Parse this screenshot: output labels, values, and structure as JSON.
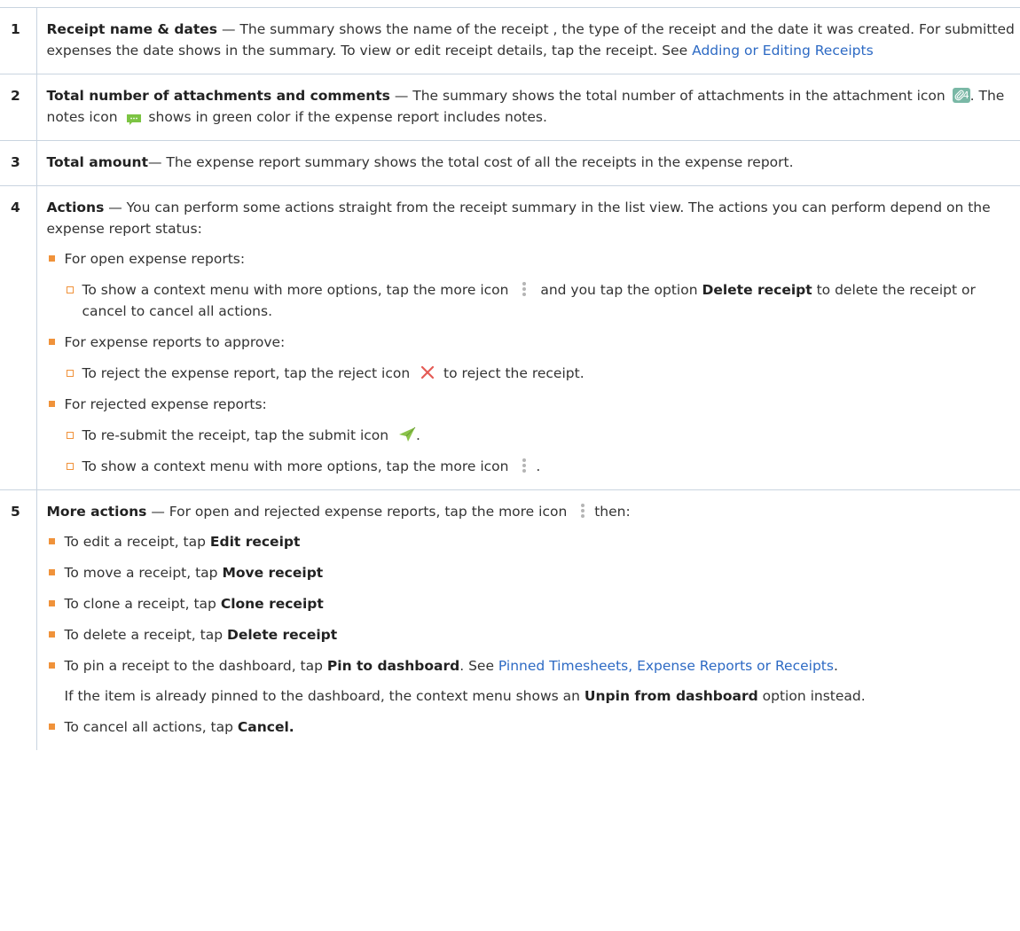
{
  "colors": {
    "link": "#2d6ac4",
    "bullet": "#f0923a",
    "divider": "#c9d4e0",
    "attachment_icon": "#7ab8a6",
    "notes_icon": "#7cc443",
    "reject_icon": "#e45b55",
    "submit_icon": "#8bc34a",
    "more_icon": "#b5b5b5"
  },
  "rows": [
    {
      "num": "1",
      "title": "Receipt name & dates",
      "text": " — The summary shows the name of the receipt , the type of the receipt and the date it was created. For submitted expenses the date shows in the summary. To view or edit receipt details, tap the receipt. See ",
      "link": "Adding or Editing Receipts"
    },
    {
      "num": "2",
      "title": "Total number of attachments and comments",
      "text_a": " — The summary shows the total number of attachments in the attachment icon ",
      "attach_count": "4",
      "text_b": ". The notes icon ",
      "text_c": " shows in green color if the expense report includes notes.",
      "icons": [
        "attachment-icon",
        "notes-icon"
      ]
    },
    {
      "num": "3",
      "title": "Total amount",
      "text": "— The expense report summary shows the total cost of all the receipts in the expense report."
    },
    {
      "num": "4",
      "title": "Actions",
      "text": " — You can perform some actions straight from the receipt summary in the list view. The actions you can perform depend on the expense report status:",
      "items": [
        {
          "label": "For open expense reports:",
          "sub_a_1": "To show a context menu with more options, tap the more icon ",
          "sub_a_bold": "Delete receipt",
          "sub_a_mid": " and you tap the option ",
          "sub_a_2": " to delete the receipt or cancel to cancel all actions."
        },
        {
          "label": "For expense reports to approve:",
          "sub_b_1": "To reject the expense report, tap the reject icon ",
          "sub_b_2": " to reject the receipt."
        },
        {
          "label": "For rejected expense reports:",
          "sub_c_1": "To re-submit the receipt, tap the submit icon ",
          "sub_c_2": ".",
          "sub_d_1": "To show a context menu with more options, tap the more icon ",
          "sub_d_2": "."
        }
      ],
      "icons": [
        "more-icon",
        "reject-icon",
        "submit-icon"
      ]
    },
    {
      "num": "5",
      "title": "More actions",
      "text_a": " — For open and rejected expense reports, tap the more icon ",
      "text_b": "then:",
      "items": [
        {
          "pre": "To edit a receipt, tap ",
          "bold": "Edit receipt"
        },
        {
          "pre": "To move a receipt, tap ",
          "bold": "Move receipt"
        },
        {
          "pre": "To clone a receipt, tap ",
          "bold": "Clone receipt"
        },
        {
          "pre": "To delete a receipt, tap ",
          "bold": "Delete receipt"
        },
        {
          "pre": "To pin a receipt to the dashboard, tap ",
          "bold": "Pin to dashboard",
          "post": ". See ",
          "link": "Pinned Timesheets, Expense Reports or Receipts",
          "end": ".",
          "note_pre": "If the item is already pinned to the dashboard, the context menu shows an ",
          "note_bold": "Unpin from dashboard",
          "note_post": " option instead."
        },
        {
          "pre": "To cancel all actions, tap ",
          "bold": "Cancel."
        }
      ]
    }
  ]
}
